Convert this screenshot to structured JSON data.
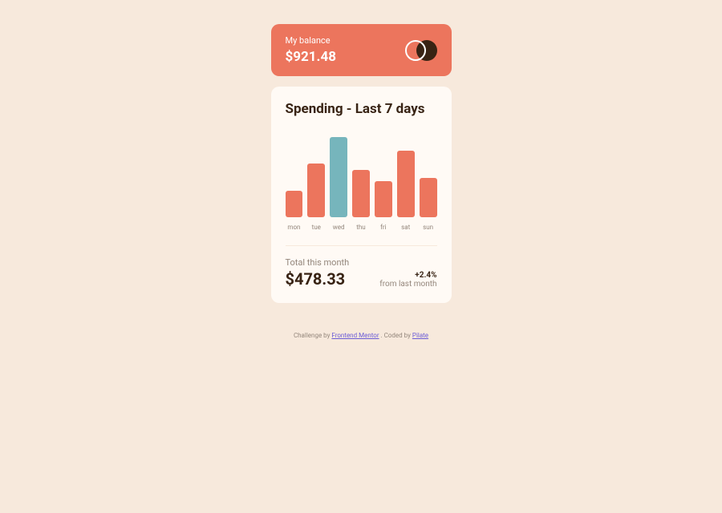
{
  "balance": {
    "label": "My balance",
    "amount": "$921.48"
  },
  "spending": {
    "title": "Spending - Last 7 days",
    "total_label": "Total this month",
    "total_amount": "$478.33",
    "delta": "+2.4%",
    "delta_label": "from last month"
  },
  "chart_data": {
    "type": "bar",
    "title": "Spending - Last 7 days",
    "categories": [
      "mon",
      "tue",
      "wed",
      "thu",
      "fri",
      "sat",
      "sun"
    ],
    "values": [
      17.45,
      34.91,
      52.36,
      31.07,
      23.39,
      43.28,
      25.48
    ],
    "xlabel": "",
    "ylabel": "",
    "ylim": [
      0,
      55
    ]
  },
  "attribution": {
    "prefix": "Challenge by ",
    "link1_text": "Frontend Mentor",
    "middle": ". Coded by ",
    "link2_text": "Pilate"
  }
}
